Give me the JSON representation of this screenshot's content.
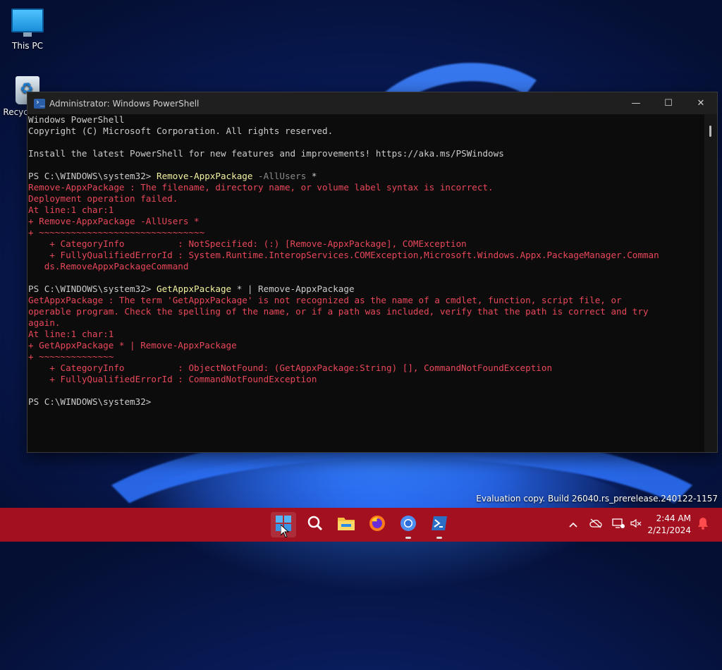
{
  "desktop": {
    "icons": [
      {
        "label": "This PC",
        "icon": "this-pc-icon"
      },
      {
        "label": "Recycle Bin",
        "icon": "recycle-bin-icon"
      }
    ]
  },
  "window": {
    "title": "Administrator: Windows PowerShell",
    "controls": {
      "minimize": "—",
      "maximize": "☐",
      "close": "✕"
    }
  },
  "console": {
    "lines": [
      {
        "t": "plain",
        "text": "Windows PowerShell"
      },
      {
        "t": "plain",
        "text": "Copyright (C) Microsoft Corporation. All rights reserved."
      },
      {
        "t": "plain",
        "text": ""
      },
      {
        "t": "plain",
        "text": "Install the latest PowerShell for new features and improvements! https://aka.ms/PSWindows"
      },
      {
        "t": "plain",
        "text": ""
      },
      {
        "t": "prompt",
        "prompt": "PS C:\\WINDOWS\\system32> ",
        "cmd": "Remove-AppxPackage",
        "param": " -AllUsers",
        "rest": " *"
      },
      {
        "t": "err",
        "text": "Remove-AppxPackage : The filename, directory name, or volume label syntax is incorrect."
      },
      {
        "t": "err",
        "text": "Deployment operation failed."
      },
      {
        "t": "err",
        "text": "At line:1 char:1"
      },
      {
        "t": "err",
        "text": "+ Remove-AppxPackage -AllUsers *"
      },
      {
        "t": "err",
        "text": "+ ~~~~~~~~~~~~~~~~~~~~~~~~~~~~~~~"
      },
      {
        "t": "err",
        "text": "    + CategoryInfo          : NotSpecified: (:) [Remove-AppxPackage], COMException"
      },
      {
        "t": "err",
        "text": "    + FullyQualifiedErrorId : System.Runtime.InteropServices.COMException,Microsoft.Windows.Appx.PackageManager.Comman"
      },
      {
        "t": "err",
        "text": "   ds.RemoveAppxPackageCommand"
      },
      {
        "t": "plain",
        "text": ""
      },
      {
        "t": "prompt",
        "prompt": "PS C:\\WINDOWS\\system32> ",
        "cmd": "GetAppxPackage",
        "param": "",
        "rest": " * | Remove-AppxPackage"
      },
      {
        "t": "err",
        "text": "GetAppxPackage : The term 'GetAppxPackage' is not recognized as the name of a cmdlet, function, script file, or"
      },
      {
        "t": "err",
        "text": "operable program. Check the spelling of the name, or if a path was included, verify that the path is correct and try"
      },
      {
        "t": "err",
        "text": "again."
      },
      {
        "t": "err",
        "text": "At line:1 char:1"
      },
      {
        "t": "err",
        "text": "+ GetAppxPackage * | Remove-AppxPackage"
      },
      {
        "t": "err",
        "text": "+ ~~~~~~~~~~~~~~"
      },
      {
        "t": "err",
        "text": "    + CategoryInfo          : ObjectNotFound: (GetAppxPackage:String) [], CommandNotFoundException"
      },
      {
        "t": "err",
        "text": "    + FullyQualifiedErrorId : CommandNotFoundException"
      },
      {
        "t": "plain",
        "text": ""
      },
      {
        "t": "prompt",
        "prompt": "PS C:\\WINDOWS\\system32> ",
        "cmd": "",
        "param": "",
        "rest": ""
      }
    ]
  },
  "watermark": "Evaluation copy. Build 26040.rs_prerelease.240122-1157",
  "taskbar": {
    "apps": [
      {
        "name": "start-button",
        "icon": "windows-logo-icon",
        "active": true
      },
      {
        "name": "search-button",
        "icon": "search-icon",
        "active": false
      },
      {
        "name": "file-explorer-button",
        "icon": "folder-icon",
        "active": false
      },
      {
        "name": "firefox-button",
        "icon": "firefox-icon",
        "active": false
      },
      {
        "name": "chrome-button",
        "icon": "chrome-icon",
        "active": false
      },
      {
        "name": "powershell-button",
        "icon": "powershell-icon",
        "active": false
      }
    ],
    "tray": [
      "chevron-up-icon",
      "cloud-offline-icon",
      "network-icon",
      "volume-muted-icon",
      "notification-bell-icon"
    ],
    "time": "2:44 AM",
    "date": "2/21/2024"
  },
  "colors": {
    "taskbar": "#a3101f",
    "error": "#e8485a",
    "command": "#f2f2a0",
    "console_bg": "#0c0c0c"
  }
}
